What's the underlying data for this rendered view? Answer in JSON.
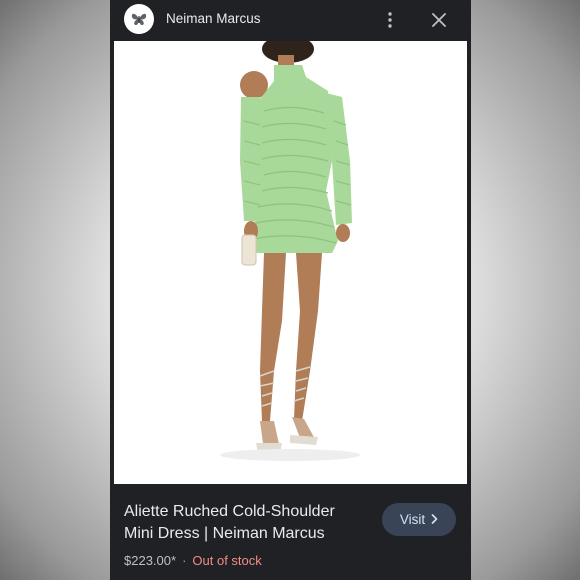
{
  "header": {
    "site_name": "Neiman Marcus",
    "logo_icon": "butterfly-icon",
    "more_icon": "more-vert-icon",
    "close_icon": "close-icon"
  },
  "product": {
    "title": "Aliette Ruched Cold-Shoulder Mini Dress | Neiman Marcus",
    "price": "$223.00*",
    "separator": "·",
    "stock_status": "Out of stock",
    "visit_label": "Visit",
    "visit_icon": "chevron-right-icon",
    "image_subject": "product-photo-green-dress"
  },
  "colors": {
    "panel_bg": "#202124",
    "dress": "#a9d99a",
    "stock": "#f28b82",
    "button_bg": "#394457",
    "button_text": "#d2e3fc"
  }
}
